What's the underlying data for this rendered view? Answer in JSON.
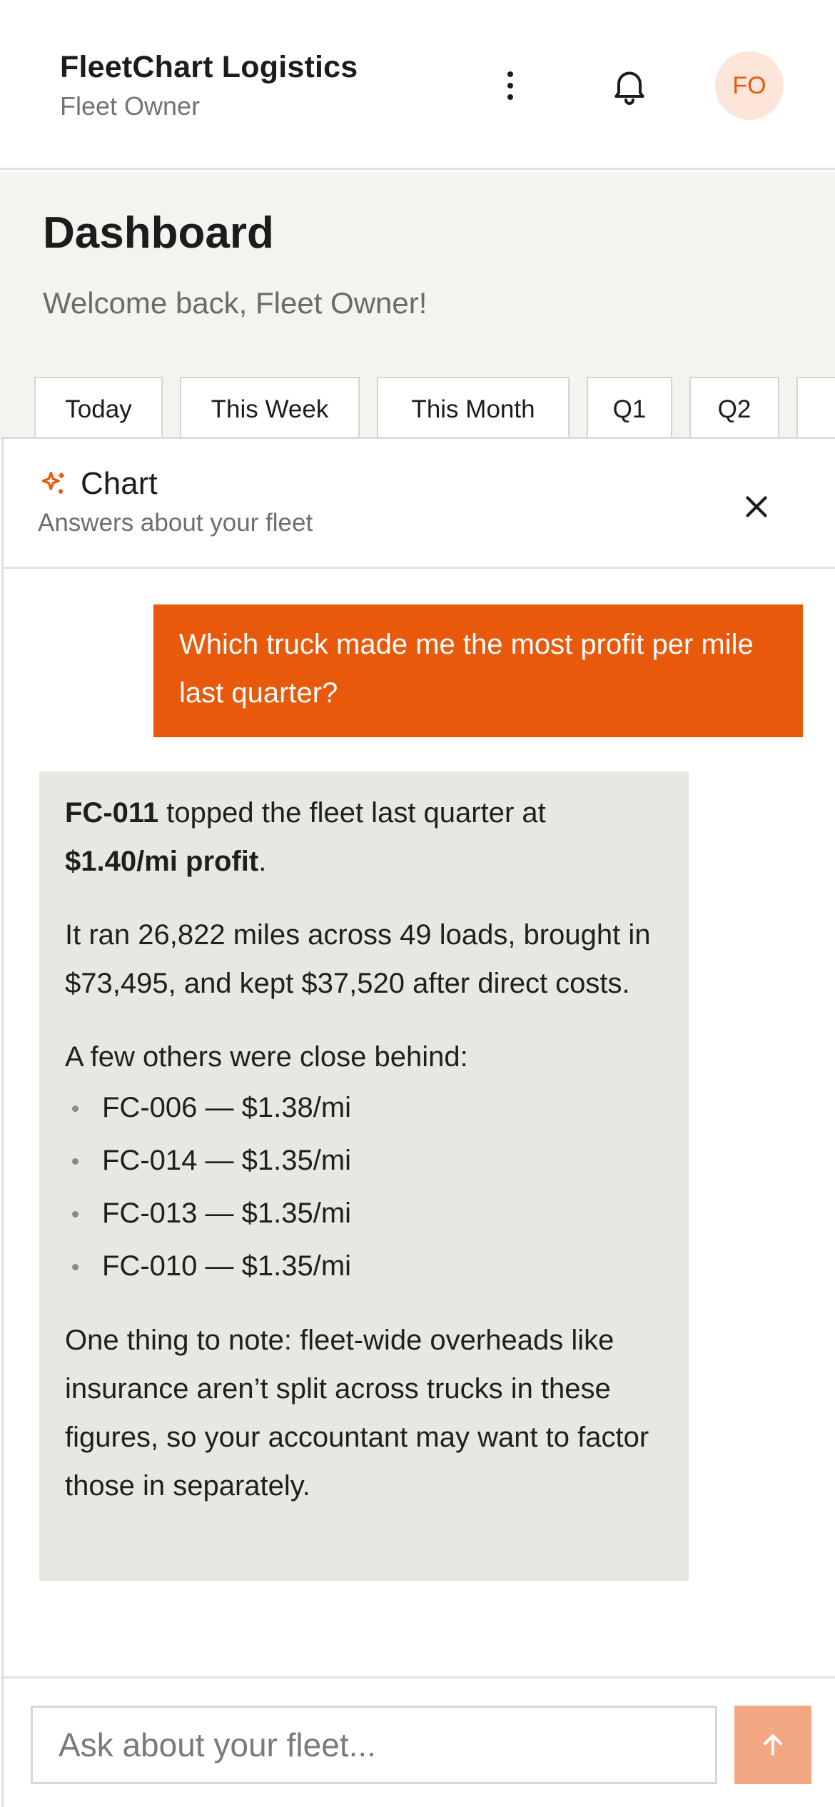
{
  "header": {
    "title": "FleetChart Logistics",
    "subtitle": "Fleet Owner",
    "avatar_initials": "FO",
    "icons": [
      "more-vertical-icon",
      "bell-icon"
    ]
  },
  "dashboard": {
    "title": "Dashboard",
    "welcome": "Welcome back, Fleet Owner!",
    "ranges": [
      "Today",
      "This Week",
      "This Month",
      "Q1",
      "Q2"
    ]
  },
  "chat": {
    "title": "Chart",
    "subtitle": "Answers about your fleet",
    "icons": [
      "sparkle-icon",
      "close-icon"
    ],
    "user_message": "Which truck made me the most profit per mile last quarter?",
    "reply": {
      "truck": "FC-011",
      "lead": " topped the fleet last quarter at ",
      "profit": "$1.40/mi profit",
      "period": ".",
      "details": "It ran 26,822 miles across 49 loads, brought in $73,495, and kept $37,520 after direct costs.",
      "runners_intro": "A few others were close behind:",
      "runners": [
        "FC-006 — $1.38/mi",
        "FC-014 — $1.35/mi",
        "FC-013 — $1.35/mi",
        "FC-010 — $1.35/mi"
      ],
      "note": "One thing to note: fleet-wide overheads like insurance aren’t split across trucks in these figures, so your accountant may want to factor those in separately."
    },
    "input_placeholder": "Ask about your fleet...",
    "send_icon": "arrow-up-icon"
  },
  "colors": {
    "accent": "#e8590c",
    "send_disabled": "#f4a783",
    "avatar_bg": "#fde6d9",
    "bot_bubble": "#e8e8e2",
    "dashboard_bg": "#f3f3ef"
  }
}
